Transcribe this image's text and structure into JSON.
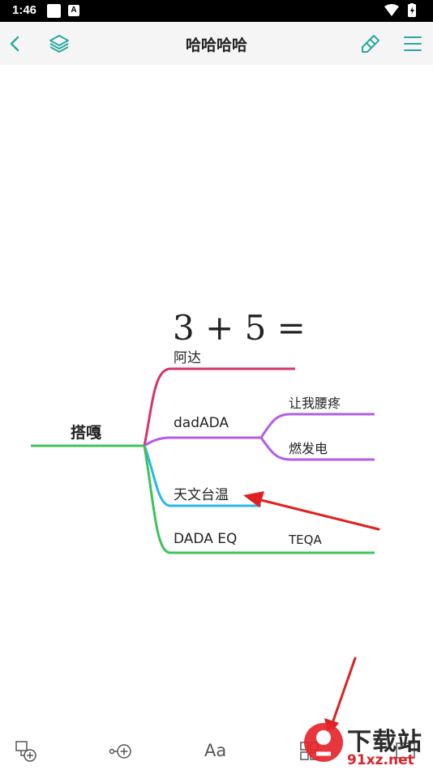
{
  "status_bar": {
    "time": "1:46",
    "badge": "A"
  },
  "header": {
    "title": "哈哈哈哈",
    "back_icon": "chevron-left-icon",
    "layers_icon": "layers-icon",
    "brush_icon": "brush-icon",
    "menu_icon": "menu-icon"
  },
  "mindmap": {
    "formula": "3 + 5 =",
    "root": "搭嘎",
    "branches": {
      "b1": "阿达",
      "b2": "dadADA",
      "b2_child1": "让我腰疼",
      "b2_child2": "燃发电",
      "b3": "天文台温",
      "b4": "DADA EQ",
      "b4_child": "TEQA"
    },
    "colors": {
      "root": "#3cc35a",
      "b1": "#d6336c",
      "b2": "#b35de6",
      "b3": "#2bb6e8",
      "b4": "#3cc35a",
      "arrow": "#e02020"
    }
  },
  "bottom_bar": {
    "font_label": "Aa",
    "watermark_brand": "下载站",
    "watermark_url": "91xz.net"
  }
}
